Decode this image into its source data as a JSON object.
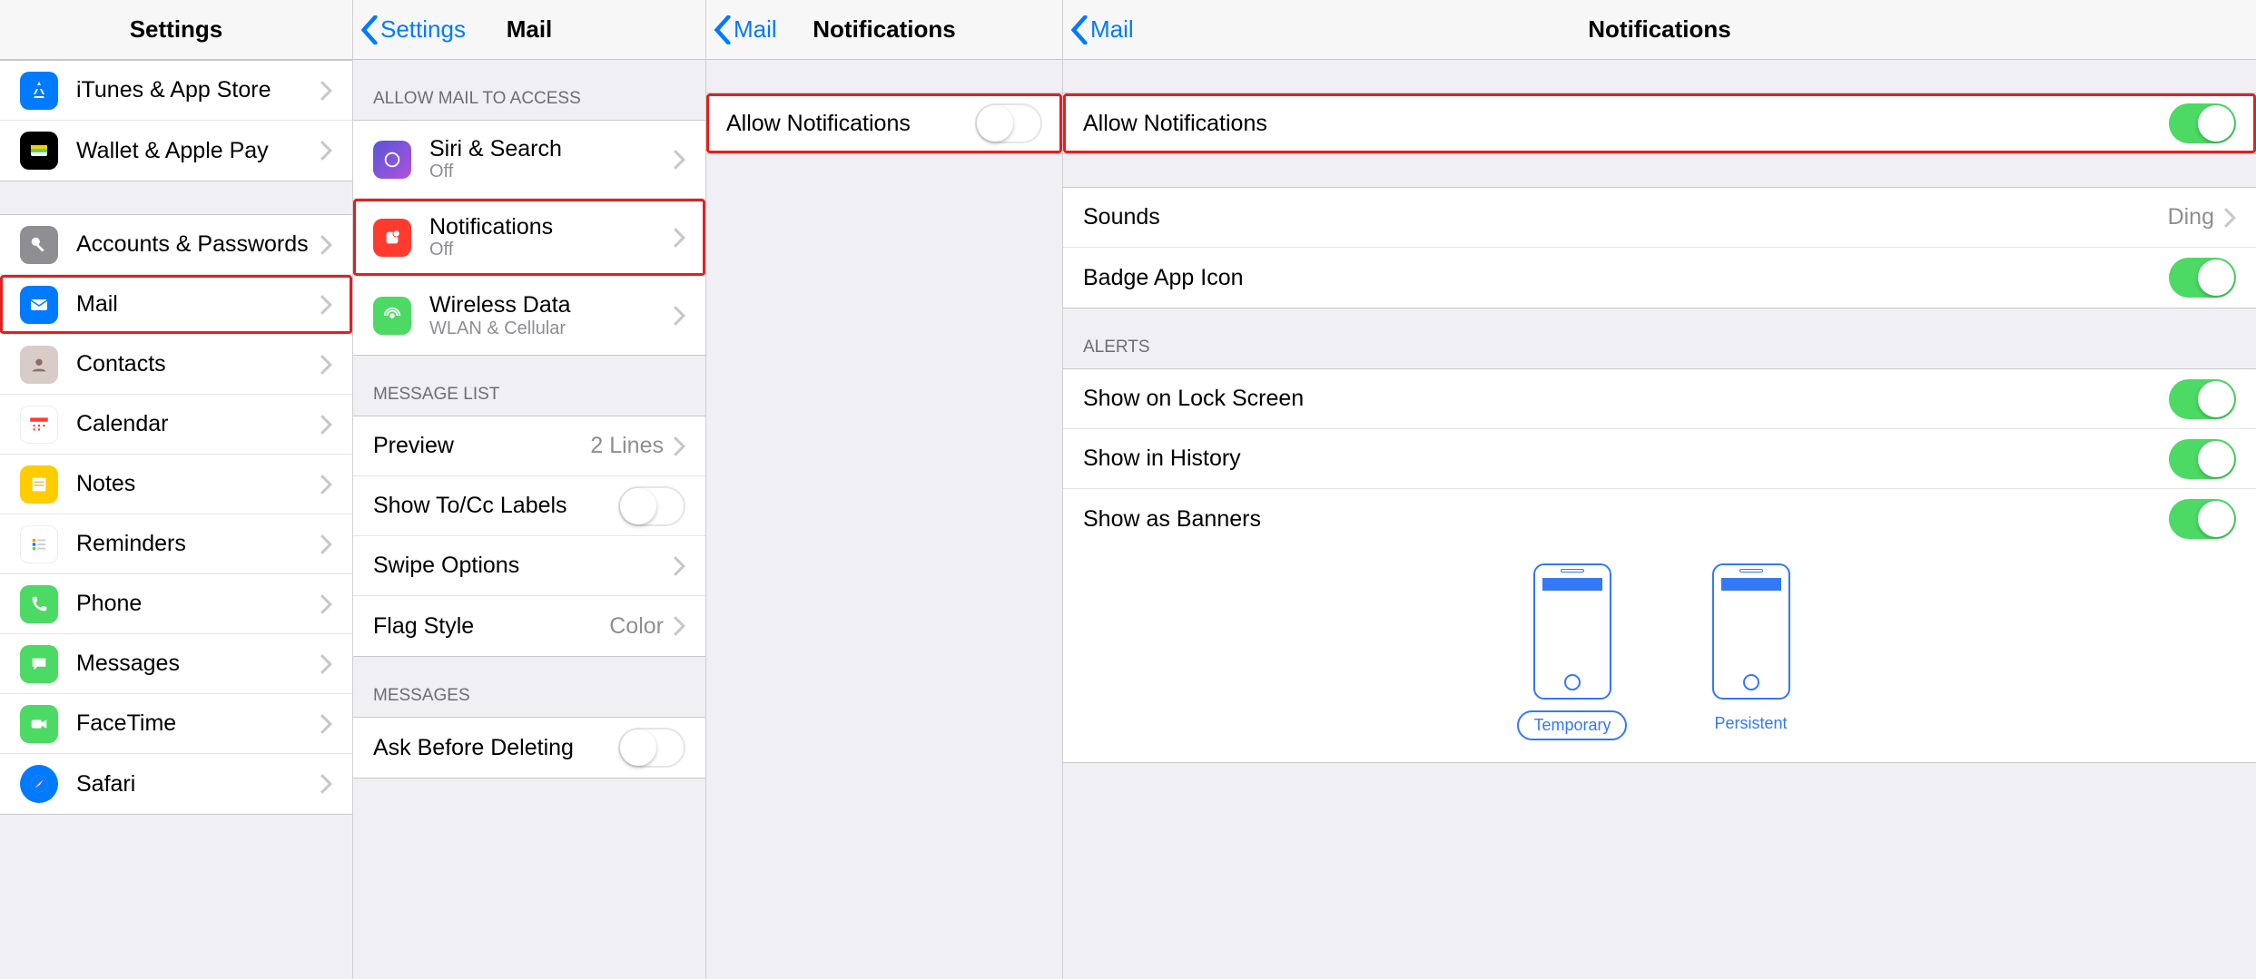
{
  "panel1": {
    "title": "Settings",
    "items": [
      {
        "label": "iTunes & App Store"
      },
      {
        "label": "Wallet & Apple Pay"
      }
    ],
    "items2": [
      {
        "label": "Accounts & Passwords"
      },
      {
        "label": "Mail"
      },
      {
        "label": "Contacts"
      },
      {
        "label": "Calendar"
      },
      {
        "label": "Notes"
      },
      {
        "label": "Reminders"
      },
      {
        "label": "Phone"
      },
      {
        "label": "Messages"
      },
      {
        "label": "FaceTime"
      },
      {
        "label": "Safari"
      }
    ]
  },
  "panel2": {
    "back": "Settings",
    "title": "Mail",
    "section1": "ALLOW MAIL TO ACCESS",
    "items1": [
      {
        "label": "Siri & Search",
        "subtitle": "Off"
      },
      {
        "label": "Notifications",
        "subtitle": "Off"
      },
      {
        "label": "Wireless Data",
        "subtitle": "WLAN & Cellular"
      }
    ],
    "section2": "MESSAGE LIST",
    "items2": [
      {
        "label": "Preview",
        "value": "2 Lines"
      },
      {
        "label": "Show To/Cc Labels"
      },
      {
        "label": "Swipe Options"
      },
      {
        "label": "Flag Style",
        "value": "Color"
      }
    ],
    "section3": "MESSAGES",
    "items3": [
      {
        "label": "Ask Before Deleting"
      }
    ]
  },
  "panel3": {
    "back": "Mail",
    "title": "Notifications",
    "row": {
      "label": "Allow Notifications"
    }
  },
  "panel4": {
    "back": "Mail",
    "title": "Notifications",
    "row": {
      "label": "Allow Notifications"
    },
    "sounds": {
      "label": "Sounds",
      "value": "Ding"
    },
    "badge": {
      "label": "Badge App Icon"
    },
    "alerts_header": "ALERTS",
    "alerts": [
      {
        "label": "Show on Lock Screen"
      },
      {
        "label": "Show in History"
      },
      {
        "label": "Show as Banners"
      }
    ],
    "preview_labels": {
      "temporary": "Temporary",
      "persistent": "Persistent"
    }
  }
}
